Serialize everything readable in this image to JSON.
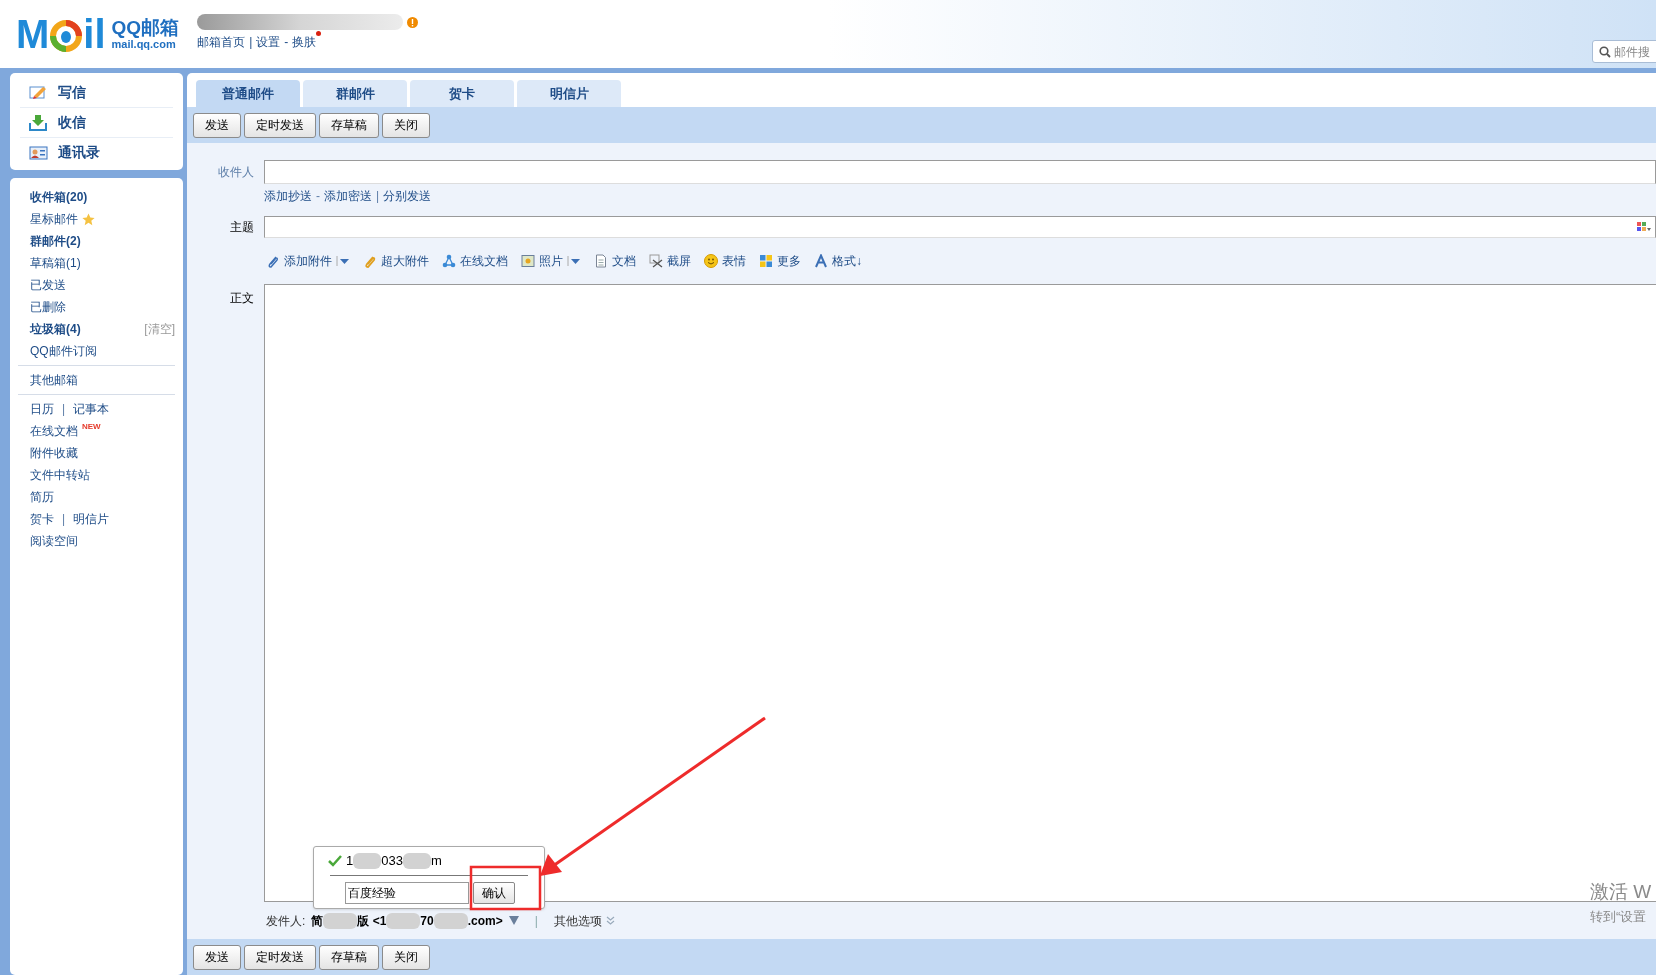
{
  "header": {
    "logo_letters": [
      "M",
      "il"
    ],
    "logo_title": "QQ邮箱",
    "logo_domain": "mail.qq.com",
    "links": [
      {
        "label": "邮箱首页"
      },
      {
        "sep": "|",
        "label": "设置"
      },
      {
        "sep": "-",
        "label": "换肤",
        "notify": true
      }
    ],
    "search_placeholder": "邮件搜"
  },
  "sidebar": {
    "actions": [
      {
        "label": "写信",
        "kind": "compose"
      },
      {
        "label": "收信",
        "kind": "receive"
      },
      {
        "label": "通讯录",
        "kind": "contacts"
      }
    ],
    "sections": [
      [
        {
          "parts": [
            "收件箱(20)"
          ],
          "bold": true
        },
        {
          "parts": [
            "星标邮件"
          ],
          "star": true
        },
        {
          "parts": [
            "群邮件(2)"
          ],
          "bold": true
        },
        {
          "parts": [
            "草稿箱(1)"
          ]
        },
        {
          "parts": [
            "已发送"
          ]
        },
        {
          "parts": [
            "已删除"
          ]
        },
        {
          "parts": [
            "垃圾箱(4)"
          ],
          "bold": true,
          "action": "[清空]"
        },
        {
          "parts": [
            "QQ邮件订阅"
          ]
        }
      ],
      [
        {
          "parts": [
            "其他邮箱"
          ]
        }
      ],
      [
        {
          "parts": [
            "日历",
            "记事本"
          ],
          "sep": "|"
        },
        {
          "parts": [
            "在线文档"
          ],
          "badge": "NEW"
        },
        {
          "parts": [
            "附件收藏"
          ]
        },
        {
          "parts": [
            "文件中转站"
          ]
        },
        {
          "parts": [
            "简历"
          ]
        },
        {
          "parts": [
            "贺卡",
            "明信片"
          ],
          "sep": "|"
        },
        {
          "parts": [
            "阅读空间"
          ]
        }
      ]
    ]
  },
  "tabs": [
    {
      "label": "普通邮件",
      "selected": true
    },
    {
      "label": "群邮件",
      "selected": false
    },
    {
      "label": "贺卡",
      "selected": false
    },
    {
      "label": "明信片",
      "selected": false
    }
  ],
  "top_toolbar": [
    "发送",
    "定时发送",
    "存草稿",
    "关闭"
  ],
  "form": {
    "recipient_label": "收件人",
    "recipient_links": [
      {
        "label": "添加抄送"
      },
      {
        "sep": "-",
        "label": "添加密送"
      },
      {
        "sep": "|",
        "label": "分别发送"
      }
    ],
    "subject_label": "主题",
    "tools": [
      {
        "label": "添加附件",
        "kind": "attach",
        "dropdown": true
      },
      {
        "label": "超大附件",
        "kind": "bigattach",
        "dropdown": false
      },
      {
        "label": "在线文档",
        "kind": "share",
        "dropdown": false
      },
      {
        "label": "照片",
        "kind": "photo",
        "dropdown": true
      },
      {
        "label": "文档",
        "kind": "doc",
        "dropdown": false
      },
      {
        "label": "截屏",
        "kind": "screenshot",
        "dropdown": false
      },
      {
        "label": "表情",
        "kind": "emoji",
        "dropdown": false
      },
      {
        "label": "更多",
        "kind": "more",
        "dropdown": false
      },
      {
        "label": "格式↓",
        "kind": "format",
        "dropdown": false
      }
    ],
    "body_label": "正文",
    "sender_label": "发件人:",
    "sender_segments": [
      {
        "kind": "text",
        "text": "简"
      },
      {
        "kind": "blur"
      },
      {
        "kind": "text",
        "text": "版 <1"
      },
      {
        "kind": "blur"
      },
      {
        "kind": "text",
        "text": "70"
      },
      {
        "kind": "blur"
      },
      {
        "kind": "text",
        "text": ".com>"
      }
    ],
    "sender_sep": "|",
    "other_options": "其他选项"
  },
  "popup": {
    "address_segments": [
      {
        "kind": "text",
        "text": "1"
      },
      {
        "kind": "blur"
      },
      {
        "kind": "text",
        "text": "033"
      },
      {
        "kind": "blur"
      },
      {
        "kind": "text",
        "text": "m"
      }
    ],
    "input_value": "百度经验",
    "confirm": "确认"
  },
  "bottom_toolbar": [
    "发送",
    "定时发送",
    "存草稿",
    "关闭"
  ],
  "system_notice": [
    "激活 W",
    "转到“设置"
  ]
}
